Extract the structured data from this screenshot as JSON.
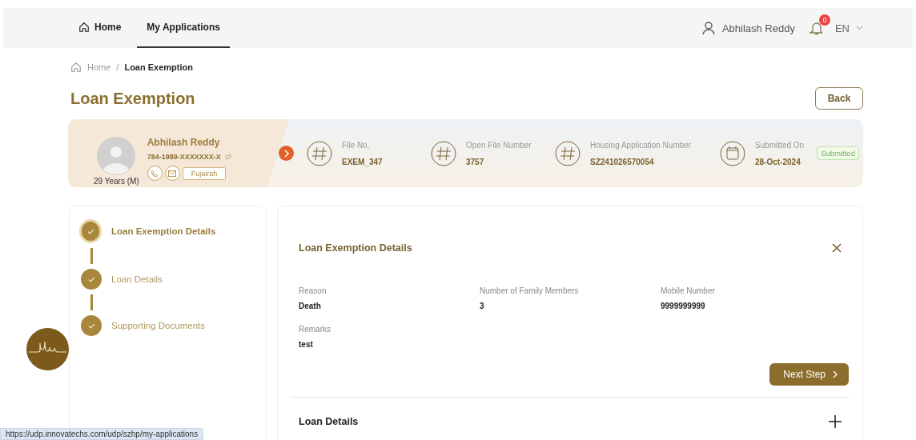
{
  "nav": {
    "items": [
      {
        "label": "Home",
        "selected": false
      },
      {
        "label": "My Applications",
        "selected": true
      }
    ],
    "user_name": "Abhilash Reddy",
    "notification_count": "0",
    "language": "EN"
  },
  "breadcrumb": {
    "separator": "/",
    "items": [
      {
        "label": "Home"
      },
      {
        "label": "Loan Exemption"
      }
    ]
  },
  "page_title": "Loan Exemption",
  "back_button": "Back",
  "applicant": {
    "name": "Abhilash Reddy",
    "id_number": "784-1989-XXXXXXX-X",
    "age_gender": "29 Years (M)",
    "emirate": "Fujairah"
  },
  "file_info": [
    {
      "label": "File No.",
      "value": "EXEM_347",
      "kind": "hash"
    },
    {
      "label": "Open File Number",
      "value": "3757",
      "kind": "hash"
    },
    {
      "label": "Housing Application Number",
      "value": "SZ241026570054",
      "kind": "hash"
    },
    {
      "label": "Submitted On",
      "value": "28-Oct-2024",
      "kind": "calendar"
    }
  ],
  "status_badge": "Submitted",
  "steps": [
    {
      "label": "Loan Exemption Details",
      "selected": true,
      "completed": true
    },
    {
      "label": "Loan Details",
      "selected": false,
      "completed": true
    },
    {
      "label": "Supporting Documents",
      "selected": false,
      "completed": true
    }
  ],
  "sections": [
    {
      "title": "Loan Exemption Details",
      "expanded": true,
      "fields": [
        {
          "label": "Reason",
          "value": "Death"
        },
        {
          "label": "Number of Family Members",
          "value": "3"
        },
        {
          "label": "Mobile Number",
          "value": "9999999999"
        },
        {
          "label": "Remarks",
          "value": "test"
        }
      ],
      "next_button": "Next Step"
    },
    {
      "title": "Loan Details",
      "expanded": false
    }
  ],
  "status_url": "https://udp.innovatechs.com/udp/szhp/my-applications"
}
